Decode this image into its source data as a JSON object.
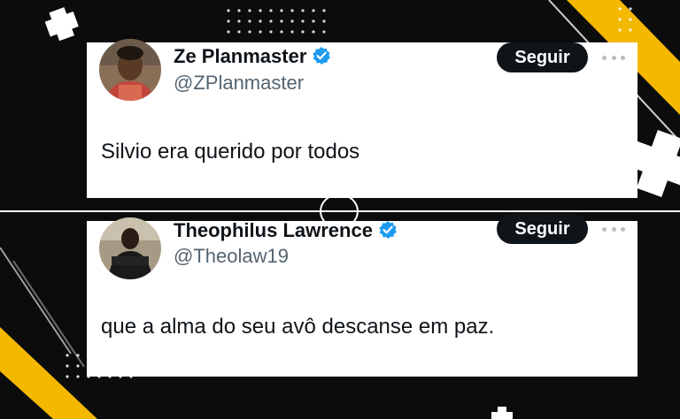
{
  "tweets": [
    {
      "name": "Ze Planmaster",
      "handle": "@ZPlanmaster",
      "follow_label": "Seguir",
      "text": "Silvio era querido por todos"
    },
    {
      "name": "Theophilus Lawrence",
      "handle": "@Theolaw19",
      "follow_label": "Seguir",
      "text": "que a alma do seu avô descanse em paz."
    }
  ],
  "colors": {
    "verified": "#1d9bf0",
    "accent_yellow": "#f5b800",
    "button_bg": "#0f1419",
    "handle_gray": "#536471"
  }
}
